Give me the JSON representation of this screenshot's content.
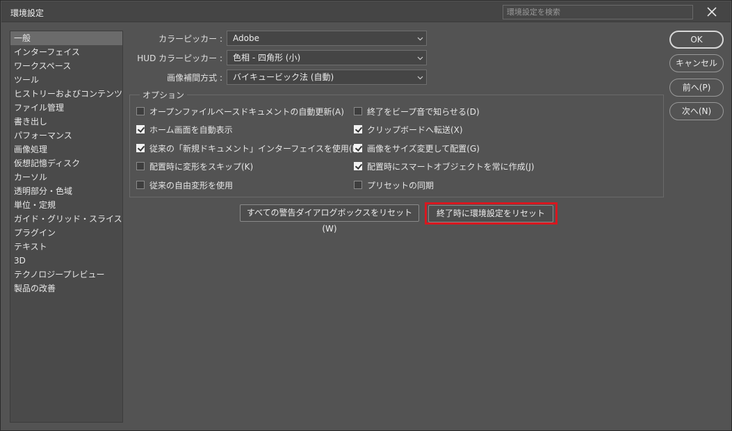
{
  "window": {
    "title": "環境設定"
  },
  "search": {
    "placeholder": "環境設定を検索"
  },
  "sidebar": {
    "items": [
      {
        "label": "一般",
        "selected": true
      },
      {
        "label": "インターフェイス"
      },
      {
        "label": "ワークスペース"
      },
      {
        "label": "ツール"
      },
      {
        "label": "ヒストリーおよびコンテンツ認証 ..."
      },
      {
        "label": "ファイル管理"
      },
      {
        "label": "書き出し"
      },
      {
        "label": "パフォーマンス"
      },
      {
        "label": "画像処理"
      },
      {
        "label": "仮想記憶ディスク"
      },
      {
        "label": "カーソル"
      },
      {
        "label": "透明部分・色域"
      },
      {
        "label": "単位・定規"
      },
      {
        "label": "ガイド・グリッド・スライス"
      },
      {
        "label": "プラグイン"
      },
      {
        "label": "テキスト"
      },
      {
        "label": "3D"
      },
      {
        "label": "テクノロジープレビュー"
      },
      {
        "label": "製品の改善"
      }
    ]
  },
  "settings": {
    "color_picker": {
      "label": "カラーピッカー :",
      "value": "Adobe"
    },
    "hud_color_picker": {
      "label": "HUD カラーピッカー :",
      "value": "色相 - 四角形 (小)"
    },
    "interpolation": {
      "label": "画像補間方式 :",
      "value": "バイキュービック法 (自動)"
    }
  },
  "options": {
    "legend": "オプション",
    "left": [
      {
        "label": "オープンファイルベースドキュメントの自動更新(A)",
        "checked": false
      },
      {
        "label": "ホーム画面を自動表示",
        "checked": true
      },
      {
        "label": "従来の「新規ドキュメント」インターフェイスを使用(L)",
        "checked": true
      },
      {
        "label": "配置時に変形をスキップ(K)",
        "checked": false
      },
      {
        "label": "従来の自由変形を使用",
        "checked": false
      }
    ],
    "right": [
      {
        "label": "終了をビープ音で知らせる(D)",
        "checked": false
      },
      {
        "label": "クリップボードへ転送(X)",
        "checked": true
      },
      {
        "label": "画像をサイズ変更して配置(G)",
        "checked": true
      },
      {
        "label": "配置時にスマートオブジェクトを常に作成(J)",
        "checked": true
      },
      {
        "label": "プリセットの同期",
        "checked": false
      }
    ]
  },
  "reset_buttons": {
    "warnings": "すべての警告ダイアログボックスをリセット (W)",
    "prefs": "終了時に環境設定をリセット"
  },
  "actions": {
    "ok": "OK",
    "cancel": "キャンセル",
    "prev": "前へ(P)",
    "next": "次へ(N)"
  },
  "colors": {
    "highlight": "#d8171f",
    "background": "#535353"
  }
}
